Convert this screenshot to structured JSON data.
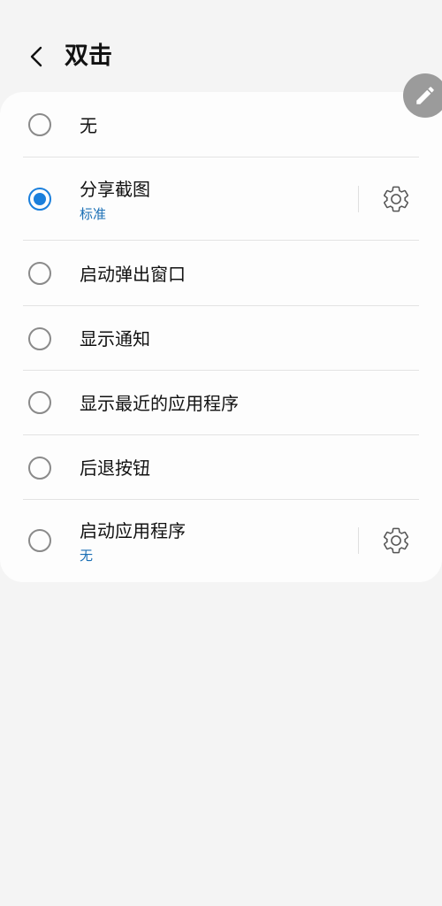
{
  "header": {
    "title": "双击",
    "back_icon": "chevron-left-icon",
    "edit_icon": "pencil-icon"
  },
  "options": [
    {
      "label": "无",
      "selected": false
    },
    {
      "label": "分享截图",
      "sublabel": "标准",
      "selected": true,
      "has_settings": true
    },
    {
      "label": "启动弹出窗口",
      "selected": false
    },
    {
      "label": "显示通知",
      "selected": false
    },
    {
      "label": "显示最近的应用程序",
      "selected": false
    },
    {
      "label": "后退按钮",
      "selected": false
    },
    {
      "label": "启动应用程序",
      "sublabel": "无",
      "selected": false,
      "has_settings": true
    }
  ],
  "colors": {
    "accent": "#1a7fdc",
    "sublabel": "#1a6fb5",
    "background": "#f4f4f4",
    "card": "#fdfdfd",
    "fab": "#9b9b9b"
  }
}
